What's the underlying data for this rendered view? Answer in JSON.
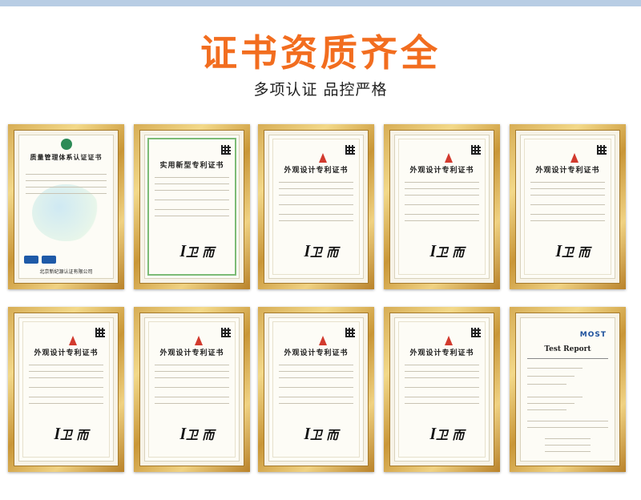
{
  "header": {
    "title": "证书资质齐全",
    "subtitle": "多项认证 品控严格"
  },
  "colors": {
    "title": "#f26d1f",
    "top_bar": "#b8cde4",
    "frame_gold": "#d7ad55"
  },
  "certificates": [
    {
      "name": "质量管理体系认证证书",
      "issuer": "北京新纪源认证有限公司",
      "kind": "qms"
    },
    {
      "name": "实用新型专利证书",
      "kind": "patent-green"
    },
    {
      "name": "外观设计专利证书",
      "kind": "patent"
    },
    {
      "name": "外观设计专利证书",
      "kind": "patent"
    },
    {
      "name": "外观设计专利证书",
      "kind": "patent"
    },
    {
      "name": "外观设计专利证书",
      "kind": "patent"
    },
    {
      "name": "外观设计专利证书",
      "kind": "patent"
    },
    {
      "name": "外观设计专利证书",
      "kind": "patent"
    },
    {
      "name": "外观设计专利证书",
      "kind": "patent"
    },
    {
      "name": "Test Report",
      "logo": "MOST",
      "kind": "report"
    }
  ]
}
